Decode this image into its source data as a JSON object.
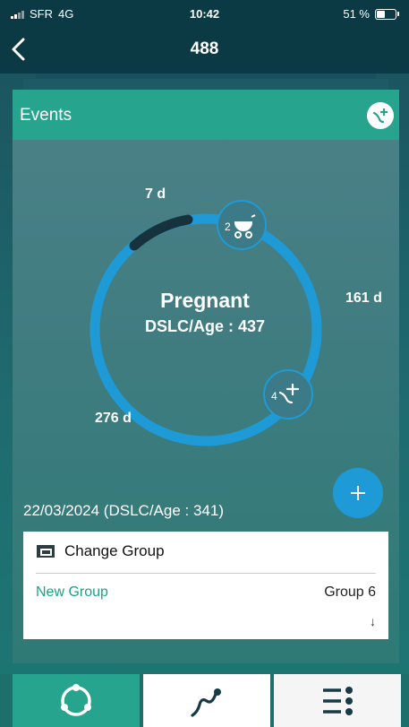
{
  "status_bar": {
    "carrier": "SFR",
    "network": "4G",
    "time": "10:42",
    "battery": "51 %",
    "battery_level": 0.51
  },
  "nav": {
    "back_icon": "chevron-left-icon",
    "title": "488"
  },
  "card": {
    "title": "Events",
    "add_icon": "add-event-icon"
  },
  "cycle": {
    "status": "Pregnant",
    "dslc_age": "DSLC/Age : 437",
    "labels": {
      "top": "7 d",
      "right": "161 d",
      "left": "276 d"
    },
    "events": [
      {
        "count": "2",
        "icon": "stroller-icon"
      },
      {
        "count": "4",
        "icon": "insemination-icon"
      }
    ],
    "colors": {
      "ring": "#1e9bd7",
      "progress": "#16333d"
    }
  },
  "fab": {
    "icon": "plus-icon"
  },
  "date_line": "22/03/2024 (DSLC/Age : 341)",
  "group": {
    "title": "Change Group",
    "new_label": "New Group",
    "value": "Group 6",
    "arrow": "↓"
  },
  "tabs": [
    {
      "icon": "cycle-icon",
      "active": true
    },
    {
      "icon": "curve-chart-icon",
      "active": false
    },
    {
      "icon": "list-icon",
      "active": false
    }
  ],
  "colors": {
    "accent": "#26a48d",
    "fab": "#1e9bd7",
    "header_bg": "#0b3a45"
  }
}
